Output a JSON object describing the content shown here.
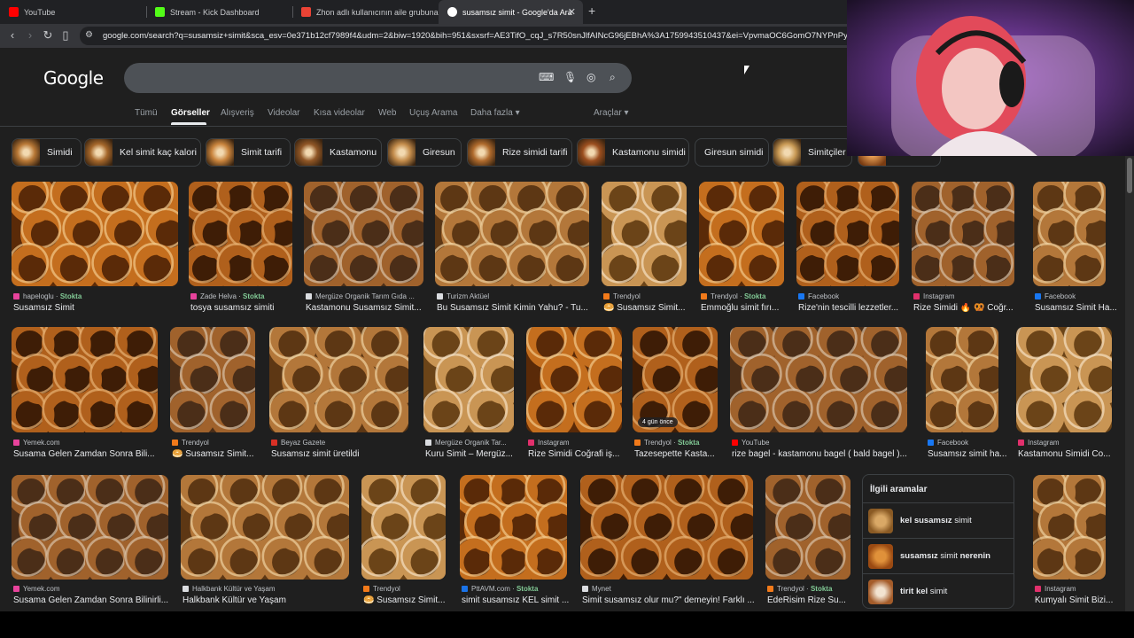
{
  "tabs": [
    {
      "title": "YouTube",
      "favicon_color": "#ff0000"
    },
    {
      "title": "Stream - Kick Dashboard",
      "favicon_color": "#53fc18"
    },
    {
      "title": "Zhon adlı kullanıcının aile grubuna ka",
      "favicon_color": "#ea4335"
    },
    {
      "title": "susamsız simit - Google'da Ara",
      "favicon_color": "#ffffff"
    }
  ],
  "url": "google.com/search?q=susamsiz+simit&sca_esv=0e371b12cf7989f4&udm=2&biw=1920&bih=951&sxsrf=AE3TifO_cqJ_s7R50snJlfAINcG96jEBhA%3A1759943510437&ei=VpvmaOC6GomO7NYPnPypiQY&v",
  "google": {
    "logo": "Google"
  },
  "filters": [
    "Tümü",
    "Görseller",
    "Alışveriş",
    "Videolar",
    "Kısa videolar",
    "Web",
    "Uçuş Arama",
    "Daha fazla"
  ],
  "tools": "Araçlar",
  "chips": [
    "Simidi",
    "Kel simit kaç kalori",
    "Simit tarifi",
    "Kastamonu",
    "Giresun",
    "Rize simidi tarifi",
    "Kastamonu simidi",
    "Giresun simidi",
    "Simitçiler"
  ],
  "results_row1": [
    {
      "source": "hapeloglu",
      "stock": "Stokta",
      "title": "Susamsız Simit",
      "fav": "#e8439c"
    },
    {
      "source": "Zade Helva",
      "stock": "Stokta",
      "title": "tosya susamsız simiti",
      "fav": "#e8439c"
    },
    {
      "source": "Mergüze Organik Tarım Gıda ...",
      "stock": "",
      "title": "Kastamonu Susamsız Simit...",
      "fav": "#dadce0"
    },
    {
      "source": "Turizm Aktüel",
      "stock": "",
      "title": "Bu Susamsız Simit Kimin Yahu? - Tu...",
      "fav": "#dadce0"
    },
    {
      "source": "Trendyol",
      "stock": "",
      "title": "🥯 Susamsız Simit...",
      "fav": "#f27a1a"
    },
    {
      "source": "Trendyol",
      "stock": "Stokta",
      "title": "Emmoğlu simit fırı...",
      "fav": "#f27a1a"
    },
    {
      "source": "Facebook",
      "stock": "",
      "title": "Rize'nin tescilli lezzetler...",
      "fav": "#1877f2"
    },
    {
      "source": "Instagram",
      "stock": "",
      "title": "Rize Simidi 🔥 🥨 Coğr...",
      "fav": "#e1306c"
    },
    {
      "source": "Facebook",
      "stock": "",
      "title": "Susamsız Simit Ha...",
      "fav": "#1877f2"
    }
  ],
  "results_row2": [
    {
      "source": "Yemek.com",
      "stock": "",
      "title": "Susama Gelen Zamdan Sonra Bili...",
      "fav": "#e8439c"
    },
    {
      "source": "Trendyol",
      "stock": "",
      "title": "🥯 Susamsız Simit...",
      "fav": "#f27a1a"
    },
    {
      "source": "Beyaz Gazete",
      "stock": "",
      "title": "Susamsız simit üretildi",
      "fav": "#d93025"
    },
    {
      "source": "Mergüze Organik Tar...",
      "stock": "",
      "title": "Kuru Simit – Mergüz...",
      "fav": "#dadce0"
    },
    {
      "source": "Instagram",
      "stock": "",
      "title": "Rize Simidi Coğrafi iş...",
      "fav": "#e1306c"
    },
    {
      "source": "Trendyol",
      "stock": "Stokta",
      "title": "Tazesepette Kasta...",
      "fav": "#f27a1a",
      "badge": "4 gün önce"
    },
    {
      "source": "YouTube",
      "stock": "",
      "title": "rize bagel - kastamonu bagel ( bald bagel )...",
      "fav": "#ff0000"
    },
    {
      "source": "Facebook",
      "stock": "",
      "title": "Susamsız simit ha...",
      "fav": "#1877f2"
    },
    {
      "source": "Instagram",
      "stock": "",
      "title": "Kastamonu Simidi Co...",
      "fav": "#e1306c"
    }
  ],
  "results_row3": [
    {
      "source": "Yemek.com",
      "stock": "",
      "title": "Susama Gelen Zamdan Sonra Bilinirli...",
      "fav": "#e8439c"
    },
    {
      "source": "Halkbank Kültür ve Yaşam",
      "stock": "",
      "title": "Halkbank Kültür ve Yaşam",
      "fav": "#dadce0"
    },
    {
      "source": "Trendyol",
      "stock": "",
      "title": "🥯 Susamsız Simit...",
      "fav": "#f27a1a"
    },
    {
      "source": "PttAVM.com",
      "stock": "Stokta",
      "title": "simit susamsız KEL simit ...",
      "fav": "#1a73e8"
    },
    {
      "source": "Mynet",
      "stock": "",
      "title": "Simit susamsız olur mu?\" demeyin! Farklı ...",
      "fav": "#dadce0"
    },
    {
      "source": "Trendyol",
      "stock": "Stokta",
      "title": "EdeRisim Rize Su...",
      "fav": "#f27a1a"
    },
    {
      "source": "Instagram",
      "stock": "",
      "title": "Kumyalı Simit Bizi...",
      "fav": "#e1306c"
    }
  ],
  "related": {
    "heading": "İlgili aramalar",
    "items": [
      {
        "bold": "kel susamsız",
        "rest": " simit"
      },
      {
        "bold": "susamsız",
        "rest": " simit ",
        "bold2": "nerenin"
      },
      {
        "bold": "tirit kel",
        "rest": " simit"
      }
    ]
  }
}
